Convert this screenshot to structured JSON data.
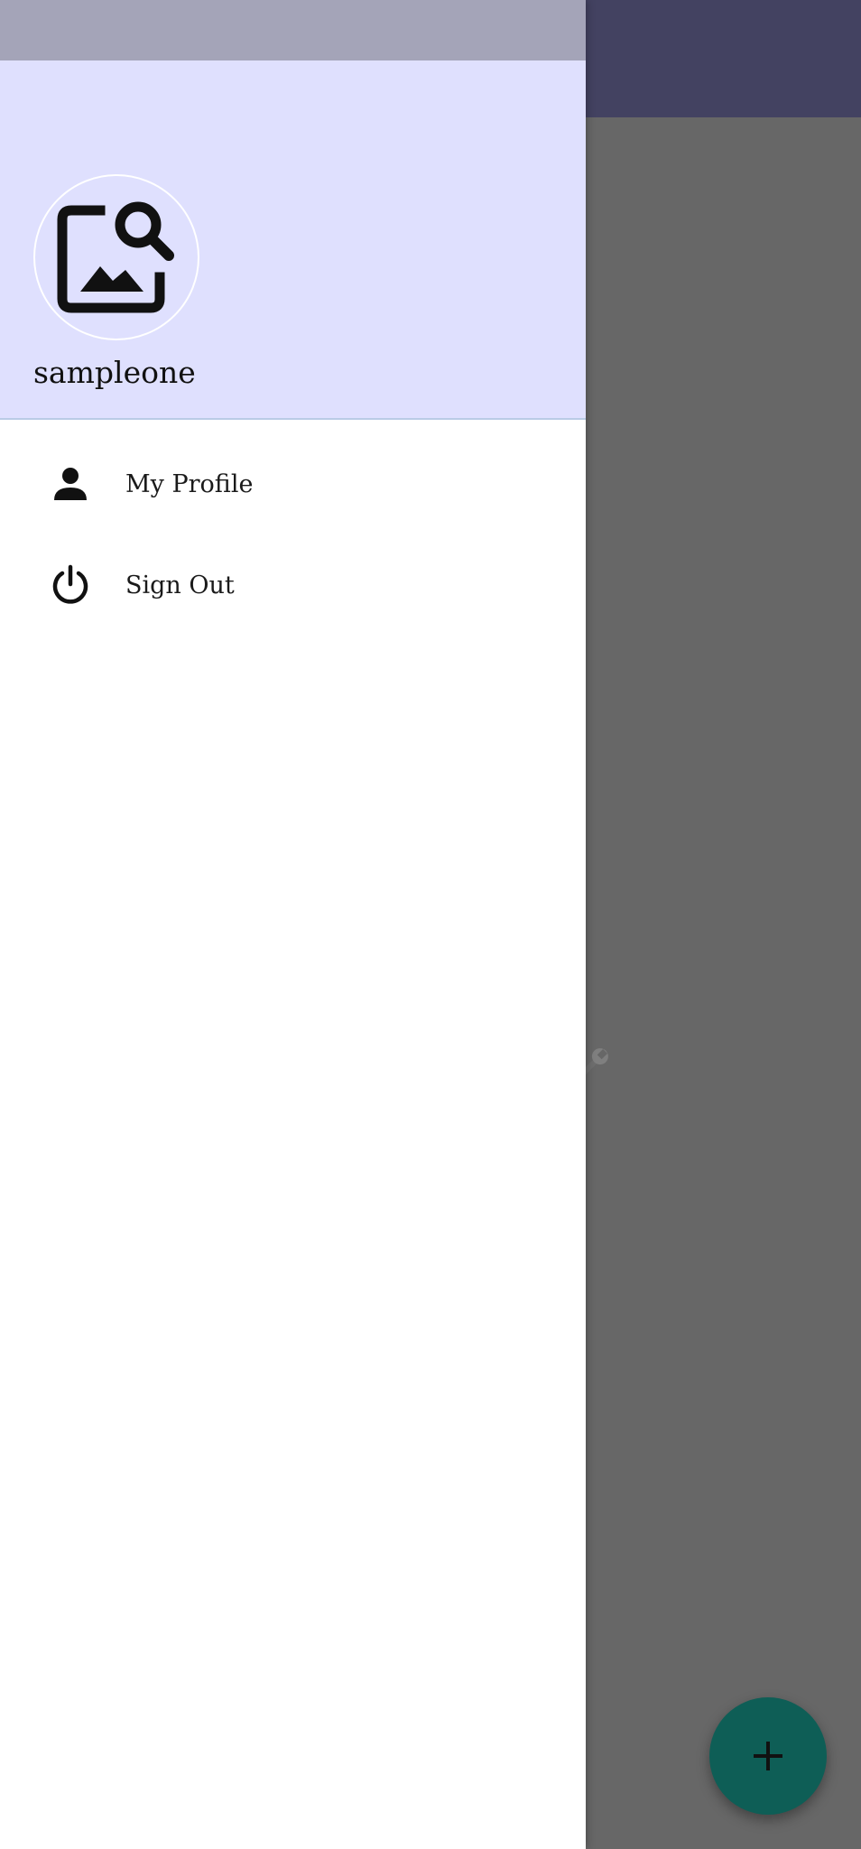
{
  "background_app": {
    "partial_text": "ce",
    "wrench_icon": "wrench-icon",
    "fab_icon": "plus-icon",
    "colors": {
      "toolbar": "#434261",
      "scrim": "#676767",
      "fab": "#0e5e56"
    }
  },
  "drawer": {
    "header": {
      "avatar_icon": "image-search-icon",
      "username": "sampleone",
      "background": "#dfe0fe"
    },
    "menu": {
      "items": [
        {
          "label": "My Profile",
          "icon": "person-icon"
        },
        {
          "label": "Sign Out",
          "icon": "power-icon"
        }
      ]
    }
  }
}
